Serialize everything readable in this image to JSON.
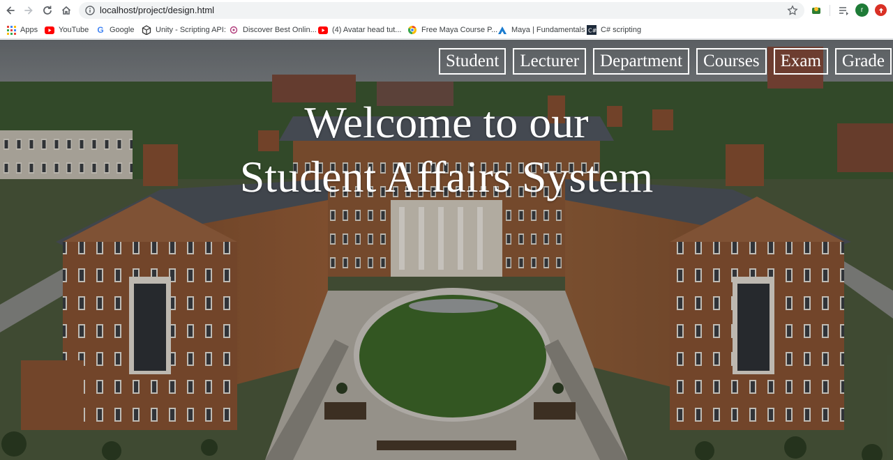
{
  "browser": {
    "url": "localhost/project/design.html",
    "profile_initial": "r"
  },
  "bookmarks": [
    {
      "label": "Apps",
      "icon": "apps-grid-icon"
    },
    {
      "label": "YouTube",
      "icon": "youtube-icon"
    },
    {
      "label": "Google",
      "icon": "google-icon"
    },
    {
      "label": "Unity - Scripting API:",
      "icon": "unity-icon"
    },
    {
      "label": "Discover Best Onlin...",
      "icon": "discover-icon"
    },
    {
      "label": "(4) Avatar head tut...",
      "icon": "youtube-icon"
    },
    {
      "label": "Free Maya Course P...",
      "icon": "maya-course-icon"
    },
    {
      "label": "Maya | Fundamentals",
      "icon": "autodesk-icon"
    },
    {
      "label": "C# scripting",
      "icon": "csharp-icon"
    }
  ],
  "nav": {
    "student": "Student",
    "lecturer": "Lecturer",
    "department": "Department",
    "courses": "Courses",
    "exam": "Exam",
    "grade": "Grade"
  },
  "hero": {
    "line1": "Welcome to our",
    "line2": "Student Affairs System"
  },
  "colors": {
    "overlay": "#000000",
    "text": "#ffffff",
    "brick": "#8a5534",
    "lawn": "#3f6a2a"
  }
}
